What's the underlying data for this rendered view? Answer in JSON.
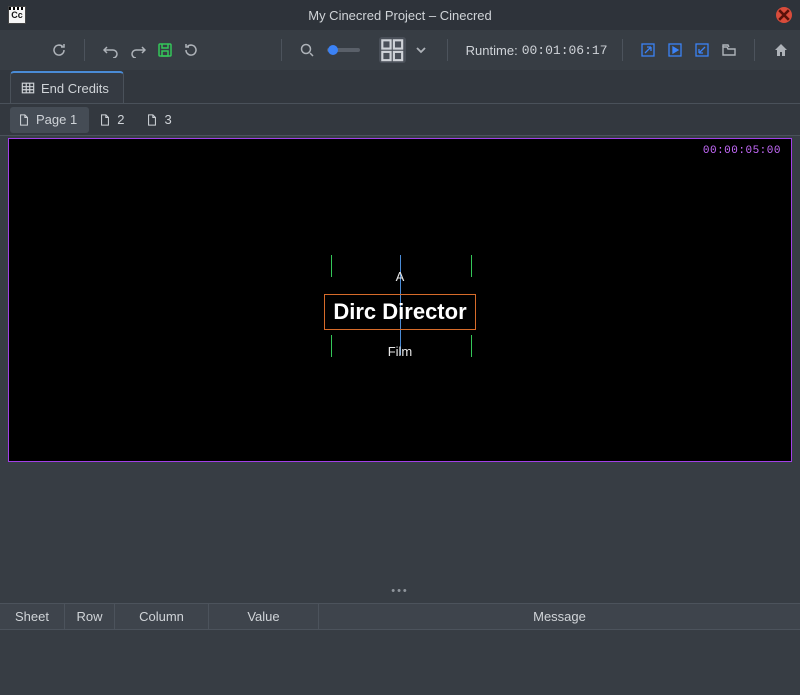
{
  "window": {
    "title": "My Cinecred Project – Cinecred",
    "app_icon_label": "Cc"
  },
  "toolbar": {
    "runtime_label": "Runtime: ",
    "runtime_value": "00:01:06:17"
  },
  "tabs": {
    "main": {
      "label": "End Credits"
    },
    "pages": [
      {
        "label": "Page 1",
        "active": true
      },
      {
        "label": "2",
        "active": false
      },
      {
        "label": "3",
        "active": false
      }
    ]
  },
  "canvas": {
    "timecode": "00:00:05:00",
    "credit_top": "A",
    "credit_main": "Dirc Director",
    "credit_sub": "Film"
  },
  "splitter": {
    "handle": "•••"
  },
  "table": {
    "columns": [
      "Sheet",
      "Row",
      "Column",
      "Value",
      "Message"
    ]
  }
}
